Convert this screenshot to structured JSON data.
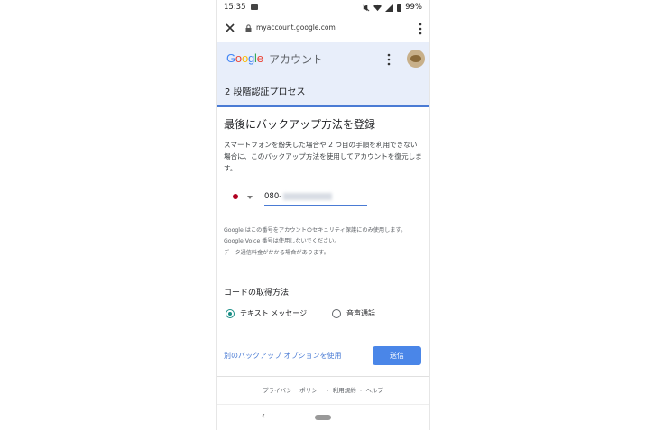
{
  "status": {
    "time": "15:35",
    "battery": "99%"
  },
  "browser": {
    "url": "myaccount.google.com"
  },
  "header": {
    "logo": {
      "g": "G",
      "o1": "o",
      "o2": "o",
      "g2": "g",
      "l": "l",
      "e": "e"
    },
    "account": "アカウント",
    "section": "2 段階認証プロセス"
  },
  "main": {
    "title": "最後にバックアップ方法を登録",
    "description": "スマートフォンを紛失した場合や 2 つ目の手順を利用できない場合に、このバックアップ方法を使用してアカウントを復元します。",
    "phone_prefix": "080-",
    "note_lines": [
      "Google はこの番号をアカウントのセキュリティ保護にのみ使用します。",
      "Google Voice 番号は使用しないでください。",
      "データ通信料金がかかる場合があります。"
    ],
    "method_title": "コードの取得方法",
    "options": [
      {
        "label": "テキスト メッセージ",
        "selected": true
      },
      {
        "label": "音声通話",
        "selected": false
      }
    ],
    "alt_link": "別のバックアップ オプションを使用",
    "send": "送信"
  },
  "footer": "プライバシー ポリシー ・ 利用規約 ・ ヘルプ",
  "nav": {
    "back": "‹"
  },
  "colors": {
    "accent": "#4a7bd4",
    "radio": "#1a8e86",
    "header_bg": "#e8eefa"
  }
}
